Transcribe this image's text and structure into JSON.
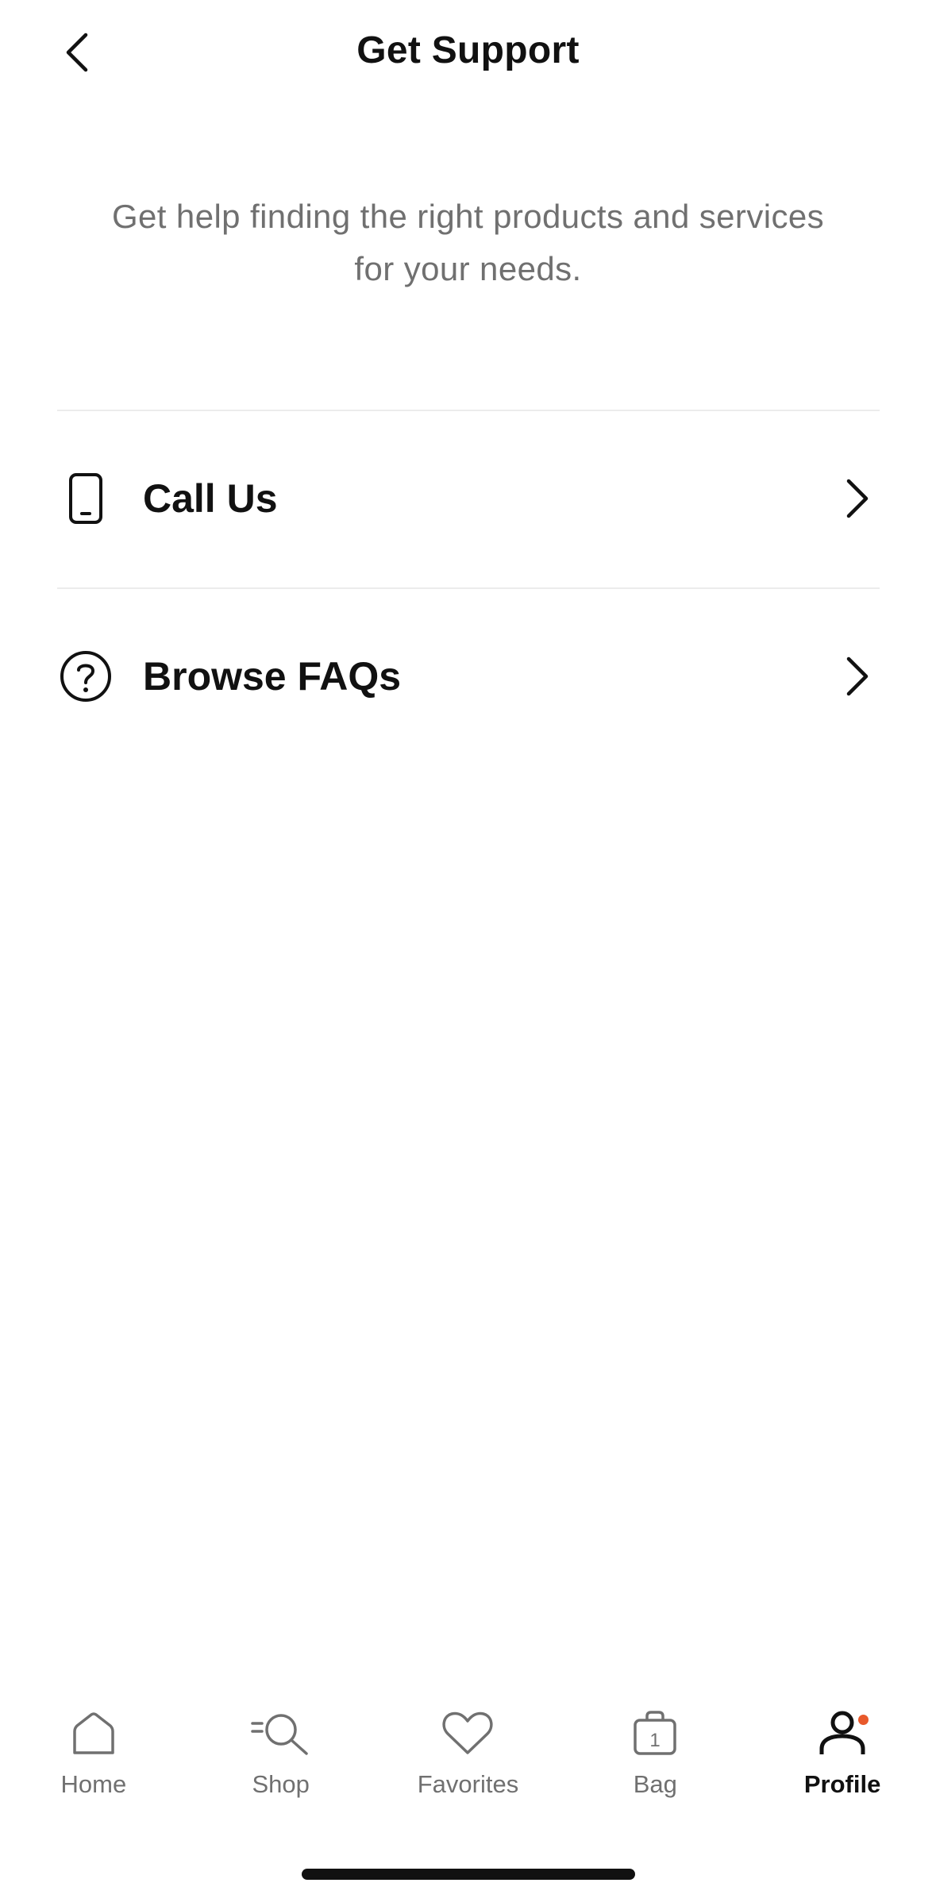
{
  "header": {
    "title": "Get Support"
  },
  "intro": {
    "text": "Get help finding the right products and services for your needs."
  },
  "options": [
    {
      "label": "Call Us",
      "icon": "phone-icon"
    },
    {
      "label": "Browse FAQs",
      "icon": "question-circle-icon"
    }
  ],
  "bottom_nav": {
    "items": [
      {
        "label": "Home",
        "icon": "home-icon",
        "active": false
      },
      {
        "label": "Shop",
        "icon": "search-icon",
        "active": false
      },
      {
        "label": "Favorites",
        "icon": "heart-icon",
        "active": false
      },
      {
        "label": "Bag",
        "icon": "bag-icon",
        "badge": "1",
        "active": false
      },
      {
        "label": "Profile",
        "icon": "profile-icon",
        "active": true
      }
    ]
  },
  "colors": {
    "text": "#111111",
    "muted": "#707070",
    "divider": "#ececec",
    "notification_dot": "#e8592b"
  }
}
